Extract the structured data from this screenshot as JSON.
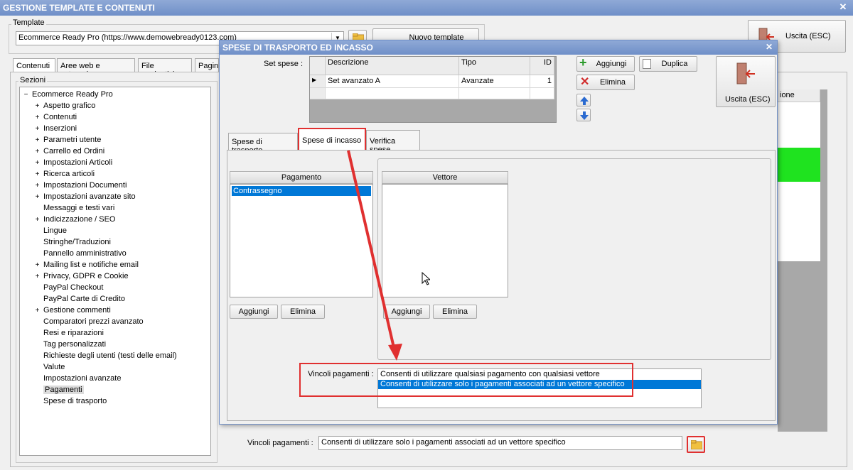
{
  "window": {
    "title": "GESTIONE TEMPLATE E CONTENUTI"
  },
  "template": {
    "group_label": "Template",
    "value": "Ecommerce Ready Pro (https://www.demowebready0123.com)",
    "new_button": "Nuovo template"
  },
  "exit_button": "Uscita (ESC)",
  "tabs": [
    {
      "label": "Contenuti"
    },
    {
      "label": "Aree web e categorie"
    },
    {
      "label": "File aggiuntivi"
    },
    {
      "label": "Pagine"
    }
  ],
  "sections": {
    "label": "Sezioni",
    "root": "Ecommerce Ready Pro",
    "items": [
      {
        "label": "Aspetto grafico",
        "expand": "+"
      },
      {
        "label": "Contenuti",
        "expand": "+"
      },
      {
        "label": "Inserzioni",
        "expand": "+"
      },
      {
        "label": "Parametri utente",
        "expand": "+"
      },
      {
        "label": "Carrello ed Ordini",
        "expand": "+"
      },
      {
        "label": "Impostazioni Articoli",
        "expand": "+"
      },
      {
        "label": "Ricerca articoli",
        "expand": "+"
      },
      {
        "label": "Impostazioni Documenti",
        "expand": "+"
      },
      {
        "label": "Impostazioni avanzate sito",
        "expand": "+"
      },
      {
        "label": "Messaggi e testi vari",
        "expand": ""
      },
      {
        "label": "Indicizzazione / SEO",
        "expand": "+"
      },
      {
        "label": "Lingue",
        "expand": ""
      },
      {
        "label": "Stringhe/Traduzioni",
        "expand": ""
      },
      {
        "label": "Pannello amministrativo",
        "expand": ""
      },
      {
        "label": "Mailing list e notifiche email",
        "expand": "+"
      },
      {
        "label": "Privacy, GDPR e Cookie",
        "expand": "+"
      },
      {
        "label": "PayPal Checkout",
        "expand": ""
      },
      {
        "label": "PayPal Carte di Credito",
        "expand": ""
      },
      {
        "label": "Gestione commenti",
        "expand": "+"
      },
      {
        "label": "Comparatori prezzi avanzato",
        "expand": ""
      },
      {
        "label": "Resi e riparazioni",
        "expand": ""
      },
      {
        "label": "Tag personalizzati",
        "expand": ""
      },
      {
        "label": "Richieste degli utenti (testi delle email)",
        "expand": ""
      },
      {
        "label": "Valute",
        "expand": ""
      },
      {
        "label": "Impostazioni avanzate",
        "expand": ""
      },
      {
        "label": "Pagamenti",
        "expand": "",
        "selected": true
      },
      {
        "label": "Spese di trasporto",
        "expand": ""
      }
    ]
  },
  "background_grid": {
    "header_fragment": "ione",
    "highlight_color": "#1fe31f"
  },
  "bottom": {
    "vincoli_label": "Vincoli pagamenti :",
    "vincoli_value": "Consenti di utilizzare solo i pagamenti associati ad un vettore specifico"
  },
  "dialog": {
    "title": "SPESE DI TRASPORTO ED INCASSO",
    "set_spese_label": "Set spese :",
    "grid": {
      "columns": [
        "Descrizione",
        "Tipo",
        "ID"
      ],
      "rows": [
        {
          "marker": "▶",
          "descrizione": "Set avanzato A",
          "tipo": "Avanzate",
          "id": "1"
        }
      ]
    },
    "buttons": {
      "aggiungi": "Aggiungi",
      "duplica": "Duplica",
      "elimina": "Elimina",
      "uscita": "Uscita (ESC)"
    },
    "tabs": [
      {
        "label": "Spese di trasporto"
      },
      {
        "label": "Spese di incasso",
        "active": true
      },
      {
        "label": "Verifica spese"
      }
    ],
    "pagamento": {
      "header": "Pagamento",
      "items": [
        "Contrassegno"
      ],
      "add": "Aggiungi",
      "remove": "Elimina"
    },
    "vettore": {
      "header": "Vettore",
      "items": [],
      "add": "Aggiungi",
      "remove": "Elimina"
    },
    "vincoli": {
      "label": "Vincoli pagamenti :",
      "options": [
        "Consenti di utilizzare qualsiasi pagamento con qualsiasi vettore",
        "Consenti di utilizzare solo i pagamenti associati ad un vettore specifico"
      ],
      "selected_index": 1
    }
  },
  "colors": {
    "title_bar": "#7594cc",
    "selection": "#0078d7",
    "annotation": "#e03030"
  }
}
